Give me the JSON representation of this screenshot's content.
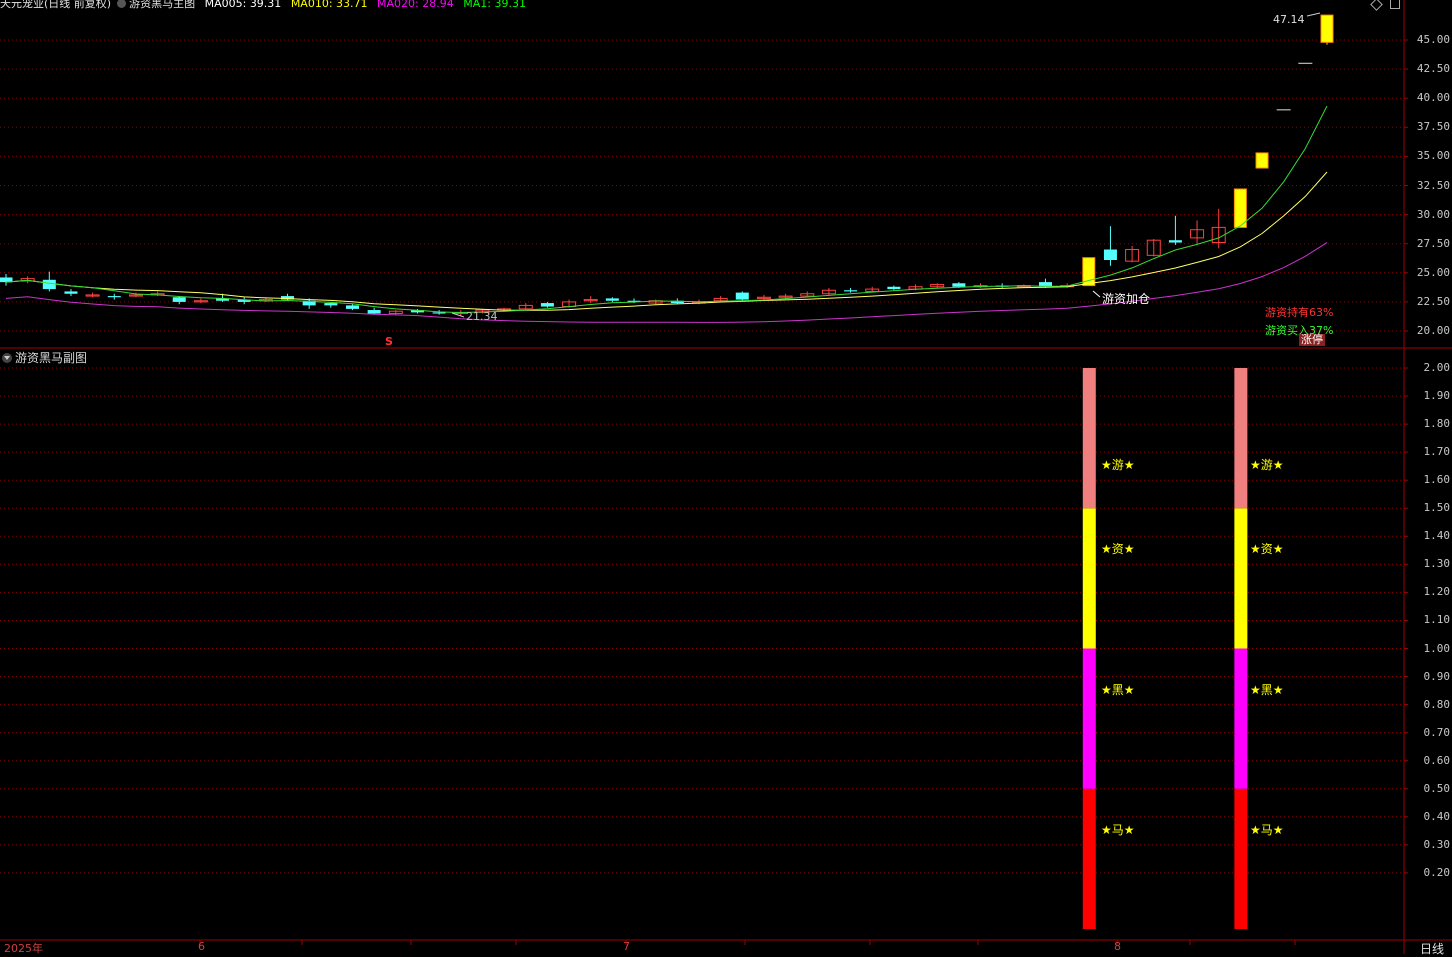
{
  "header": {
    "stock_name": "天元宠业(日线 前复权)",
    "indicator": "游资黑马主图",
    "ma": [
      {
        "label": "MA005:",
        "value": "39.31",
        "color": "#ffffff"
      },
      {
        "label": "MA010:",
        "value": "33.71",
        "color": "#ffff00"
      },
      {
        "label": "MA020:",
        "value": "28.94",
        "color": "#ff00ff"
      },
      {
        "label": "MA1:",
        "value": "39.31",
        "color": "#00ff00"
      }
    ]
  },
  "main_axis": {
    "ticks": [
      "45.00",
      "42.50",
      "40.00",
      "37.50",
      "35.00",
      "32.50",
      "30.00",
      "27.50",
      "25.00",
      "22.50",
      "20.00"
    ],
    "values": [
      45.0,
      42.5,
      40.0,
      37.5,
      35.0,
      32.5,
      30.0,
      27.5,
      25.0,
      22.5,
      20.0
    ]
  },
  "sub_axis": {
    "ticks": [
      "2.00",
      "1.90",
      "1.80",
      "1.70",
      "1.60",
      "1.50",
      "1.40",
      "1.30",
      "1.20",
      "1.10",
      "1.00",
      "0.90",
      "0.80",
      "0.70",
      "0.60",
      "0.50",
      "0.40",
      "0.30",
      "0.20"
    ],
    "values": [
      2.0,
      1.9,
      1.8,
      1.7,
      1.6,
      1.5,
      1.4,
      1.3,
      1.2,
      1.1,
      1.0,
      0.9,
      0.8,
      0.7,
      0.6,
      0.5,
      0.4,
      0.3,
      0.2
    ]
  },
  "annotations": {
    "high": "47.14",
    "low": "21.34",
    "add_position": "游资加仓",
    "hold_pct": "游资持有63%",
    "buy_pct": "游资买入37%",
    "limit_up": "涨停",
    "s_marker": "S"
  },
  "sub_chart": {
    "title": "游资黑马副图",
    "labels": [
      "★游★",
      "★资★",
      "★黑★",
      "★马★"
    ],
    "segment_colors": [
      "#f08080",
      "#ffff00",
      "#ff00ff",
      "#ff0000"
    ]
  },
  "x_axis": {
    "labels": [
      "2025年",
      "6",
      "7",
      "8"
    ]
  },
  "period_label": "日线",
  "colors": {
    "up": "#ff4040",
    "down": "#54ffff",
    "grid": "#8b0000",
    "limit_up": "#ffff00"
  },
  "chart_data": [
    {
      "type": "candlestick",
      "title": "游资黑马主图",
      "ylim": [
        20,
        47.5
      ],
      "candles": [
        {
          "o": 24.6,
          "c": 24.2,
          "h": 24.9,
          "l": 23.9
        },
        {
          "o": 24.3,
          "c": 24.5,
          "h": 24.7,
          "l": 24.1
        },
        {
          "o": 24.4,
          "c": 23.6,
          "h": 25.1,
          "l": 23.4
        },
        {
          "o": 23.4,
          "c": 23.2,
          "h": 23.6,
          "l": 23.0
        },
        {
          "o": 23.0,
          "c": 23.1,
          "h": 23.3,
          "l": 22.9
        },
        {
          "o": 23.0,
          "c": 22.9,
          "h": 23.2,
          "l": 22.7
        },
        {
          "o": 23.0,
          "c": 23.1,
          "h": 23.3,
          "l": 22.9
        },
        {
          "o": 23.1,
          "c": 23.2,
          "h": 23.4,
          "l": 23.0
        },
        {
          "o": 22.9,
          "c": 22.5,
          "h": 23.0,
          "l": 22.3
        },
        {
          "o": 22.5,
          "c": 22.6,
          "h": 22.8,
          "l": 22.4
        },
        {
          "o": 22.8,
          "c": 22.6,
          "h": 23.2,
          "l": 22.5
        },
        {
          "o": 22.7,
          "c": 22.5,
          "h": 22.9,
          "l": 22.3
        },
        {
          "o": 22.6,
          "c": 22.7,
          "h": 22.9,
          "l": 22.5
        },
        {
          "o": 23.0,
          "c": 22.7,
          "h": 23.2,
          "l": 22.6
        },
        {
          "o": 22.6,
          "c": 22.2,
          "h": 22.8,
          "l": 21.9
        },
        {
          "o": 22.4,
          "c": 22.2,
          "h": 22.5,
          "l": 22.0
        },
        {
          "o": 22.2,
          "c": 21.9,
          "h": 22.3,
          "l": 21.8
        },
        {
          "o": 21.8,
          "c": 21.5,
          "h": 22.0,
          "l": 21.4
        },
        {
          "o": 21.5,
          "c": 21.7,
          "h": 21.8,
          "l": 21.4
        },
        {
          "o": 21.8,
          "c": 21.6,
          "h": 21.9,
          "l": 21.5
        },
        {
          "o": 21.6,
          "c": 21.5,
          "h": 21.8,
          "l": 21.4
        },
        {
          "o": 21.5,
          "c": 21.6,
          "h": 21.8,
          "l": 21.3
        },
        {
          "o": 21.6,
          "c": 21.8,
          "h": 21.9,
          "l": 21.5
        },
        {
          "o": 21.8,
          "c": 21.9,
          "h": 22.0,
          "l": 21.7
        },
        {
          "o": 21.9,
          "c": 22.2,
          "h": 22.4,
          "l": 21.8
        },
        {
          "o": 22.4,
          "c": 22.1,
          "h": 22.5,
          "l": 22.0
        },
        {
          "o": 22.1,
          "c": 22.5,
          "h": 22.7,
          "l": 22.0
        },
        {
          "o": 22.6,
          "c": 22.7,
          "h": 23.0,
          "l": 22.4
        },
        {
          "o": 22.8,
          "c": 22.6,
          "h": 22.9,
          "l": 22.5
        },
        {
          "o": 22.6,
          "c": 22.5,
          "h": 22.8,
          "l": 22.4
        },
        {
          "o": 22.4,
          "c": 22.6,
          "h": 22.7,
          "l": 22.3
        },
        {
          "o": 22.6,
          "c": 22.4,
          "h": 22.8,
          "l": 22.3
        },
        {
          "o": 22.4,
          "c": 22.5,
          "h": 22.7,
          "l": 22.3
        },
        {
          "o": 22.6,
          "c": 22.8,
          "h": 23.0,
          "l": 22.5
        },
        {
          "o": 23.3,
          "c": 22.7,
          "h": 23.4,
          "l": 22.6
        },
        {
          "o": 22.8,
          "c": 22.9,
          "h": 23.1,
          "l": 22.7
        },
        {
          "o": 22.9,
          "c": 23.0,
          "h": 23.2,
          "l": 22.8
        },
        {
          "o": 23.0,
          "c": 23.2,
          "h": 23.4,
          "l": 22.9
        },
        {
          "o": 23.2,
          "c": 23.5,
          "h": 23.7,
          "l": 23.1
        },
        {
          "o": 23.5,
          "c": 23.4,
          "h": 23.7,
          "l": 23.3
        },
        {
          "o": 23.4,
          "c": 23.6,
          "h": 23.8,
          "l": 23.3
        },
        {
          "o": 23.8,
          "c": 23.6,
          "h": 23.9,
          "l": 23.5
        },
        {
          "o": 23.6,
          "c": 23.8,
          "h": 24.0,
          "l": 23.5
        },
        {
          "o": 23.8,
          "c": 24.0,
          "h": 24.1,
          "l": 23.7
        },
        {
          "o": 24.1,
          "c": 23.8,
          "h": 24.2,
          "l": 23.7
        },
        {
          "o": 23.8,
          "c": 23.9,
          "h": 24.1,
          "l": 23.7
        },
        {
          "o": 23.9,
          "c": 23.8,
          "h": 24.1,
          "l": 23.7
        },
        {
          "o": 23.8,
          "c": 23.9,
          "h": 24.0,
          "l": 23.7
        },
        {
          "o": 24.2,
          "c": 23.8,
          "h": 24.5,
          "l": 23.7
        },
        {
          "o": 23.8,
          "c": 23.9,
          "h": 24.1,
          "l": 23.7
        },
        {
          "o": 23.9,
          "c": 26.3,
          "h": 26.3,
          "l": 23.9,
          "lu": true
        },
        {
          "o": 27.0,
          "c": 26.1,
          "h": 29.0,
          "l": 25.6
        },
        {
          "o": 26.0,
          "c": 27.0,
          "h": 27.3,
          "l": 25.9
        },
        {
          "o": 26.5,
          "c": 27.8,
          "h": 27.9,
          "l": 26.4
        },
        {
          "o": 27.8,
          "c": 27.6,
          "h": 29.9,
          "l": 27.4
        },
        {
          "o": 28.0,
          "c": 28.7,
          "h": 29.5,
          "l": 27.5
        },
        {
          "o": 27.6,
          "c": 28.9,
          "h": 30.5,
          "l": 27.1
        },
        {
          "o": 28.9,
          "c": 32.2,
          "h": 32.2,
          "l": 28.9,
          "lu": true
        },
        {
          "o": 34.0,
          "c": 35.3,
          "h": 35.3,
          "l": 34.0,
          "lu": true
        },
        {
          "o": 39.0,
          "c": 39.0,
          "h": 39.0,
          "l": 39.0,
          "lu": true
        },
        {
          "o": 43.0,
          "c": 43.0,
          "h": 43.0,
          "l": 43.0,
          "lu": true
        },
        {
          "o": 44.8,
          "c": 47.14,
          "h": 47.14,
          "l": 44.6,
          "lu": true
        }
      ]
    },
    {
      "type": "bar",
      "title": "游资黑马副图",
      "ylim": [
        0,
        2.0
      ],
      "bars": [
        {
          "index": 50,
          "value": 2.0,
          "segments": [
            [
              0,
              0.5,
              "#ff0000"
            ],
            [
              0.5,
              1.0,
              "#ff00ff"
            ],
            [
              1.0,
              1.5,
              "#ffff00"
            ],
            [
              1.5,
              2.0,
              "#f08080"
            ]
          ]
        },
        {
          "index": 57,
          "value": 2.0,
          "segments": [
            [
              0,
              0.5,
              "#ff0000"
            ],
            [
              0.5,
              1.0,
              "#ff00ff"
            ],
            [
              1.0,
              1.5,
              "#ffff00"
            ],
            [
              1.5,
              2.0,
              "#f08080"
            ]
          ]
        }
      ]
    }
  ]
}
